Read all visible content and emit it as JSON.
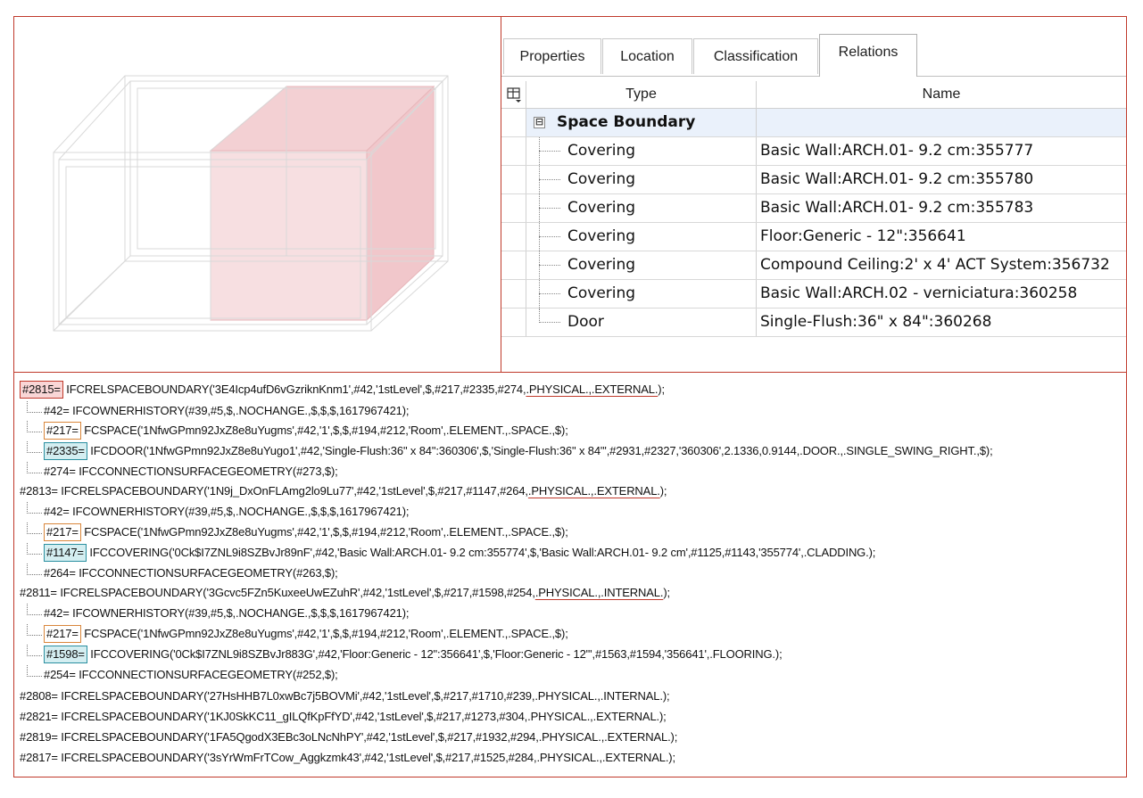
{
  "tabs": [
    {
      "label": "Properties",
      "active": false
    },
    {
      "label": "Location",
      "active": false
    },
    {
      "label": "Classification",
      "active": false
    },
    {
      "label": "Relations",
      "active": true
    }
  ],
  "grid": {
    "corner_icon": "column-chooser-icon",
    "headers": {
      "type": "Type",
      "name": "Name"
    },
    "group": {
      "label": "Space Boundary",
      "toggle": "⊟"
    },
    "rows": [
      {
        "type": "Covering",
        "name": "Basic Wall:ARCH.01- 9.2 cm:355777"
      },
      {
        "type": "Covering",
        "name": "Basic Wall:ARCH.01- 9.2 cm:355780"
      },
      {
        "type": "Covering",
        "name": "Basic Wall:ARCH.01- 9.2 cm:355783"
      },
      {
        "type": "Covering",
        "name": "Floor:Generic - 12\":356641"
      },
      {
        "type": "Covering",
        "name": "Compound Ceiling:2' x 4' ACT System:356732"
      },
      {
        "type": "Covering",
        "name": "Basic Wall:ARCH.02 - verniciatura:360258"
      },
      {
        "type": "Door",
        "name": "Single-Flush:36\" x 84\":360268"
      }
    ]
  },
  "code": {
    "l1_ref": "#2815=",
    "l1_text": " IFCRELSPACEBOUNDARY('3E4Icp4ufD6vGzriknKnm1',#42,'1stLevel',$,#217,#2335,#274,",
    "l1_ul": ".PHYSICAL.,.EXTERNAL.",
    "l1_end": ");",
    "l2": "#42= IFCOWNERHISTORY(#39,#5,$,.NOCHANGE.,$,$,$,1617967421);",
    "l3_ref": "#217=",
    "l3_text": " FCSPACE('1NfwGPmn92JxZ8e8uYugms',#42,'1',$,$,#194,#212,'Room',.ELEMENT.,.SPACE.,$);",
    "l4_ref": "#2335=",
    "l4_text": " IFCDOOR('1NfwGPmn92JxZ8e8uYugo1',#42,'Single-Flush:36\" x 84\":360306',$,'Single-Flush:36\" x 84\"',#2931,#2327,'360306',2.1336,0.9144,.DOOR.,.SINGLE_SWING_RIGHT.,$);",
    "l5": "#274= IFCCONNECTIONSURFACEGEOMETRY(#273,$);",
    "l6_text": "#2813= IFCRELSPACEBOUNDARY('1N9j_DxOnFLAmg2lo9Lu77',#42,'1stLevel',$,#217,#1147,#264,",
    "l6_ul": ".PHYSICAL.,.EXTERNAL.",
    "l6_end": ");",
    "l7": "#42= IFCOWNERHISTORY(#39,#5,$,.NOCHANGE.,$,$,$,1617967421);",
    "l8_ref": "#217=",
    "l8_text": " FCSPACE('1NfwGPmn92JxZ8e8uYugms',#42,'1',$,$,#194,#212,'Room',.ELEMENT.,.SPACE.,$);",
    "l9_ref": "#1147=",
    "l9_text": " IFCCOVERING('0Ck$I7ZNL9i8SZBvJr89nF',#42,'Basic Wall:ARCH.01- 9.2 cm:355774',$,'Basic Wall:ARCH.01- 9.2 cm',#1125,#1143,'355774',.CLADDING.);",
    "l10": "#264= IFCCONNECTIONSURFACEGEOMETRY(#263,$);",
    "l11_text": "#2811= IFCRELSPACEBOUNDARY('3Gcvc5FZn5KuxeeUwEZuhR',#42,'1stLevel',$,#217,#1598,#254,",
    "l11_ul": ".PHYSICAL.,.INTERNAL.",
    "l11_end": ");",
    "l12": "#42= IFCOWNERHISTORY(#39,#5,$,.NOCHANGE.,$,$,$,1617967421);",
    "l13_ref": "#217=",
    "l13_text": " FCSPACE('1NfwGPmn92JxZ8e8uYugms',#42,'1',$,$,#194,#212,'Room',.ELEMENT.,.SPACE.,$);",
    "l14_ref": "#1598=",
    "l14_text": " IFCCOVERING('0Ck$I7ZNL9i8SZBvJr883G',#42,'Floor:Generic - 12\":356641',$,'Floor:Generic - 12\"',#1563,#1594,'356641',.FLOORING.);",
    "l15": "#254= IFCCONNECTIONSURFACEGEOMETRY(#252,$);",
    "l16": "#2808= IFCRELSPACEBOUNDARY('27HsHHB7L0xwBc7j5BOVMi',#42,'1stLevel',$,#217,#1710,#239,.PHYSICAL.,.INTERNAL.);",
    "l17": "#2821= IFCRELSPACEBOUNDARY('1KJ0SkKC11_gILQfKpFfYD',#42,'1stLevel',$,#217,#1273,#304,.PHYSICAL.,.EXTERNAL.);",
    "l18": "#2819= IFCRELSPACEBOUNDARY('1FA5QgodX3EBc3oLNcNhPY',#42,'1stLevel',$,#217,#1932,#294,.PHYSICAL.,.EXTERNAL.);",
    "l19": "#2817= IFCRELSPACEBOUNDARY('3sYrWmFrTCow_Aggkzmk43',#42,'1stLevel',$,#217,#1525,#284,.PHYSICAL.,.EXTERNAL.);"
  },
  "colors": {
    "frame": "#c0392b",
    "highlight_face": "#f2c9cc",
    "group_bg": "#eaf1fb"
  }
}
